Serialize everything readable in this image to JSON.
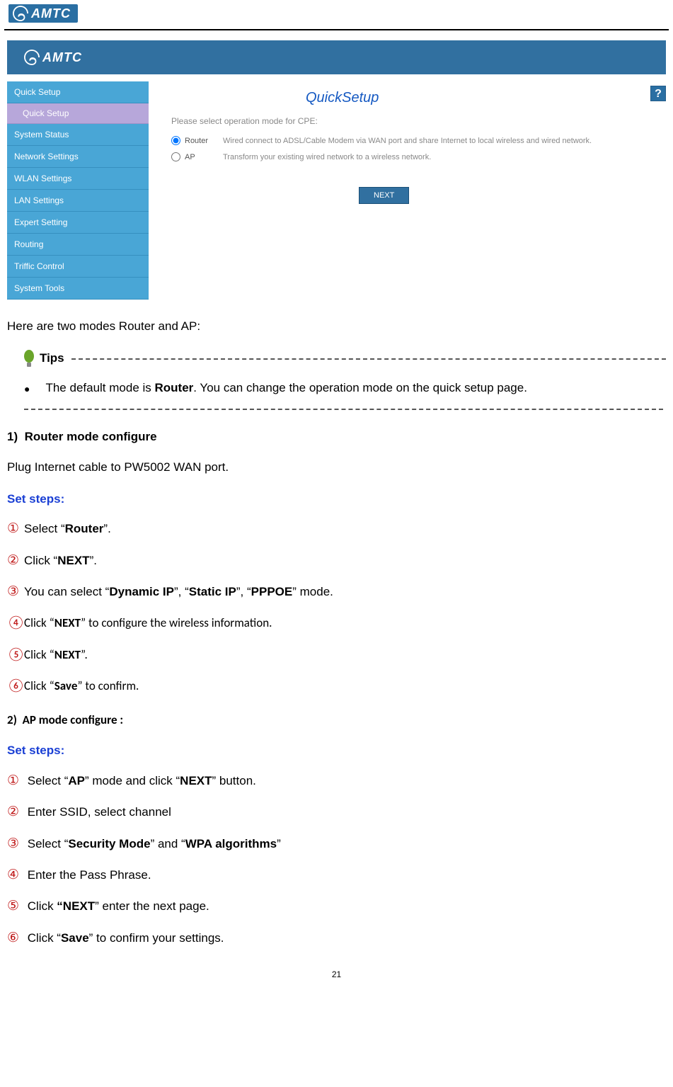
{
  "logo_text": "AMTC",
  "screenshot": {
    "sidebar": {
      "quick_setup": "Quick Setup",
      "quick_setup_sub": "Quick Setup",
      "system_status": "System Status",
      "network_settings": "Network Settings",
      "wlan_settings": "WLAN Settings",
      "lan_settings": "LAN Settings",
      "expert_setting": "Expert Setting",
      "routing": "Routing",
      "traffic_control": "Triffic Control",
      "system_tools": "System Tools"
    },
    "content": {
      "title": "QuickSetup",
      "desc": "Please select operation mode for CPE:",
      "router_label": "Router",
      "router_desc": "Wired connect to ADSL/Cable Modem via WAN port and share Internet to local wireless and wired network.",
      "ap_label": "AP",
      "ap_desc": "Transform your existing wired network to a wireless network.",
      "next_btn": "NEXT",
      "help": "?"
    }
  },
  "intro_text": "Here are two modes Router and AP:",
  "tips_label": "Tips",
  "tip_pre": "The default mode is ",
  "tip_bold": "Router",
  "tip_post": ". You can change the operation mode on the quick setup page.",
  "section1_num": "1)",
  "section1_title": "Router mode configure",
  "section1_intro": "Plug Internet cable to PW5002 WAN port.",
  "set_steps_label": "Set steps:",
  "s1": {
    "step1_a": "Select “",
    "step1_b": "Router",
    "step1_c": "”.",
    "step2_a": "Click “",
    "step2_b": "NEXT",
    "step2_c": "”.",
    "step3_a": "You can select “",
    "step3_b": "Dynamic IP",
    "step3_c": "”, “",
    "step3_d": "Static IP",
    "step3_e": "”, “",
    "step3_f": "PPPOE",
    "step3_g": "” mode.",
    "step4_a": "Click “",
    "step4_b": "NEXT",
    "step4_c": "” to configure the wireless information.",
    "step5_a": "Click “",
    "step5_b": "NEXT",
    "step5_c": "”.",
    "step6_a": "Click “",
    "step6_b": "Save",
    "step6_c": "” to confirm."
  },
  "section2_num": "2)",
  "section2_title": "AP mode configure :",
  "s2": {
    "step1_a": "Select “",
    "step1_b": "AP",
    "step1_c": "” mode and click “",
    "step1_d": "NEXT",
    "step1_e": "” button.",
    "step2": "Enter SSID, select channel",
    "step3_a": "Select “",
    "step3_b": "Security Mode",
    "step3_c": "” and “",
    "step3_d": "WPA algorithms",
    "step3_e": "”",
    "step4": "Enter the Pass Phrase.",
    "step5_a": "Click ",
    "step5_b": "“NEXT",
    "step5_c": "” enter the next page.",
    "step6_a": "Click “",
    "step6_b": "Save",
    "step6_c": "” to confirm your settings."
  },
  "circled": [
    "①",
    "②",
    "③",
    "④",
    "⑤",
    "⑥"
  ],
  "page_number": "21"
}
